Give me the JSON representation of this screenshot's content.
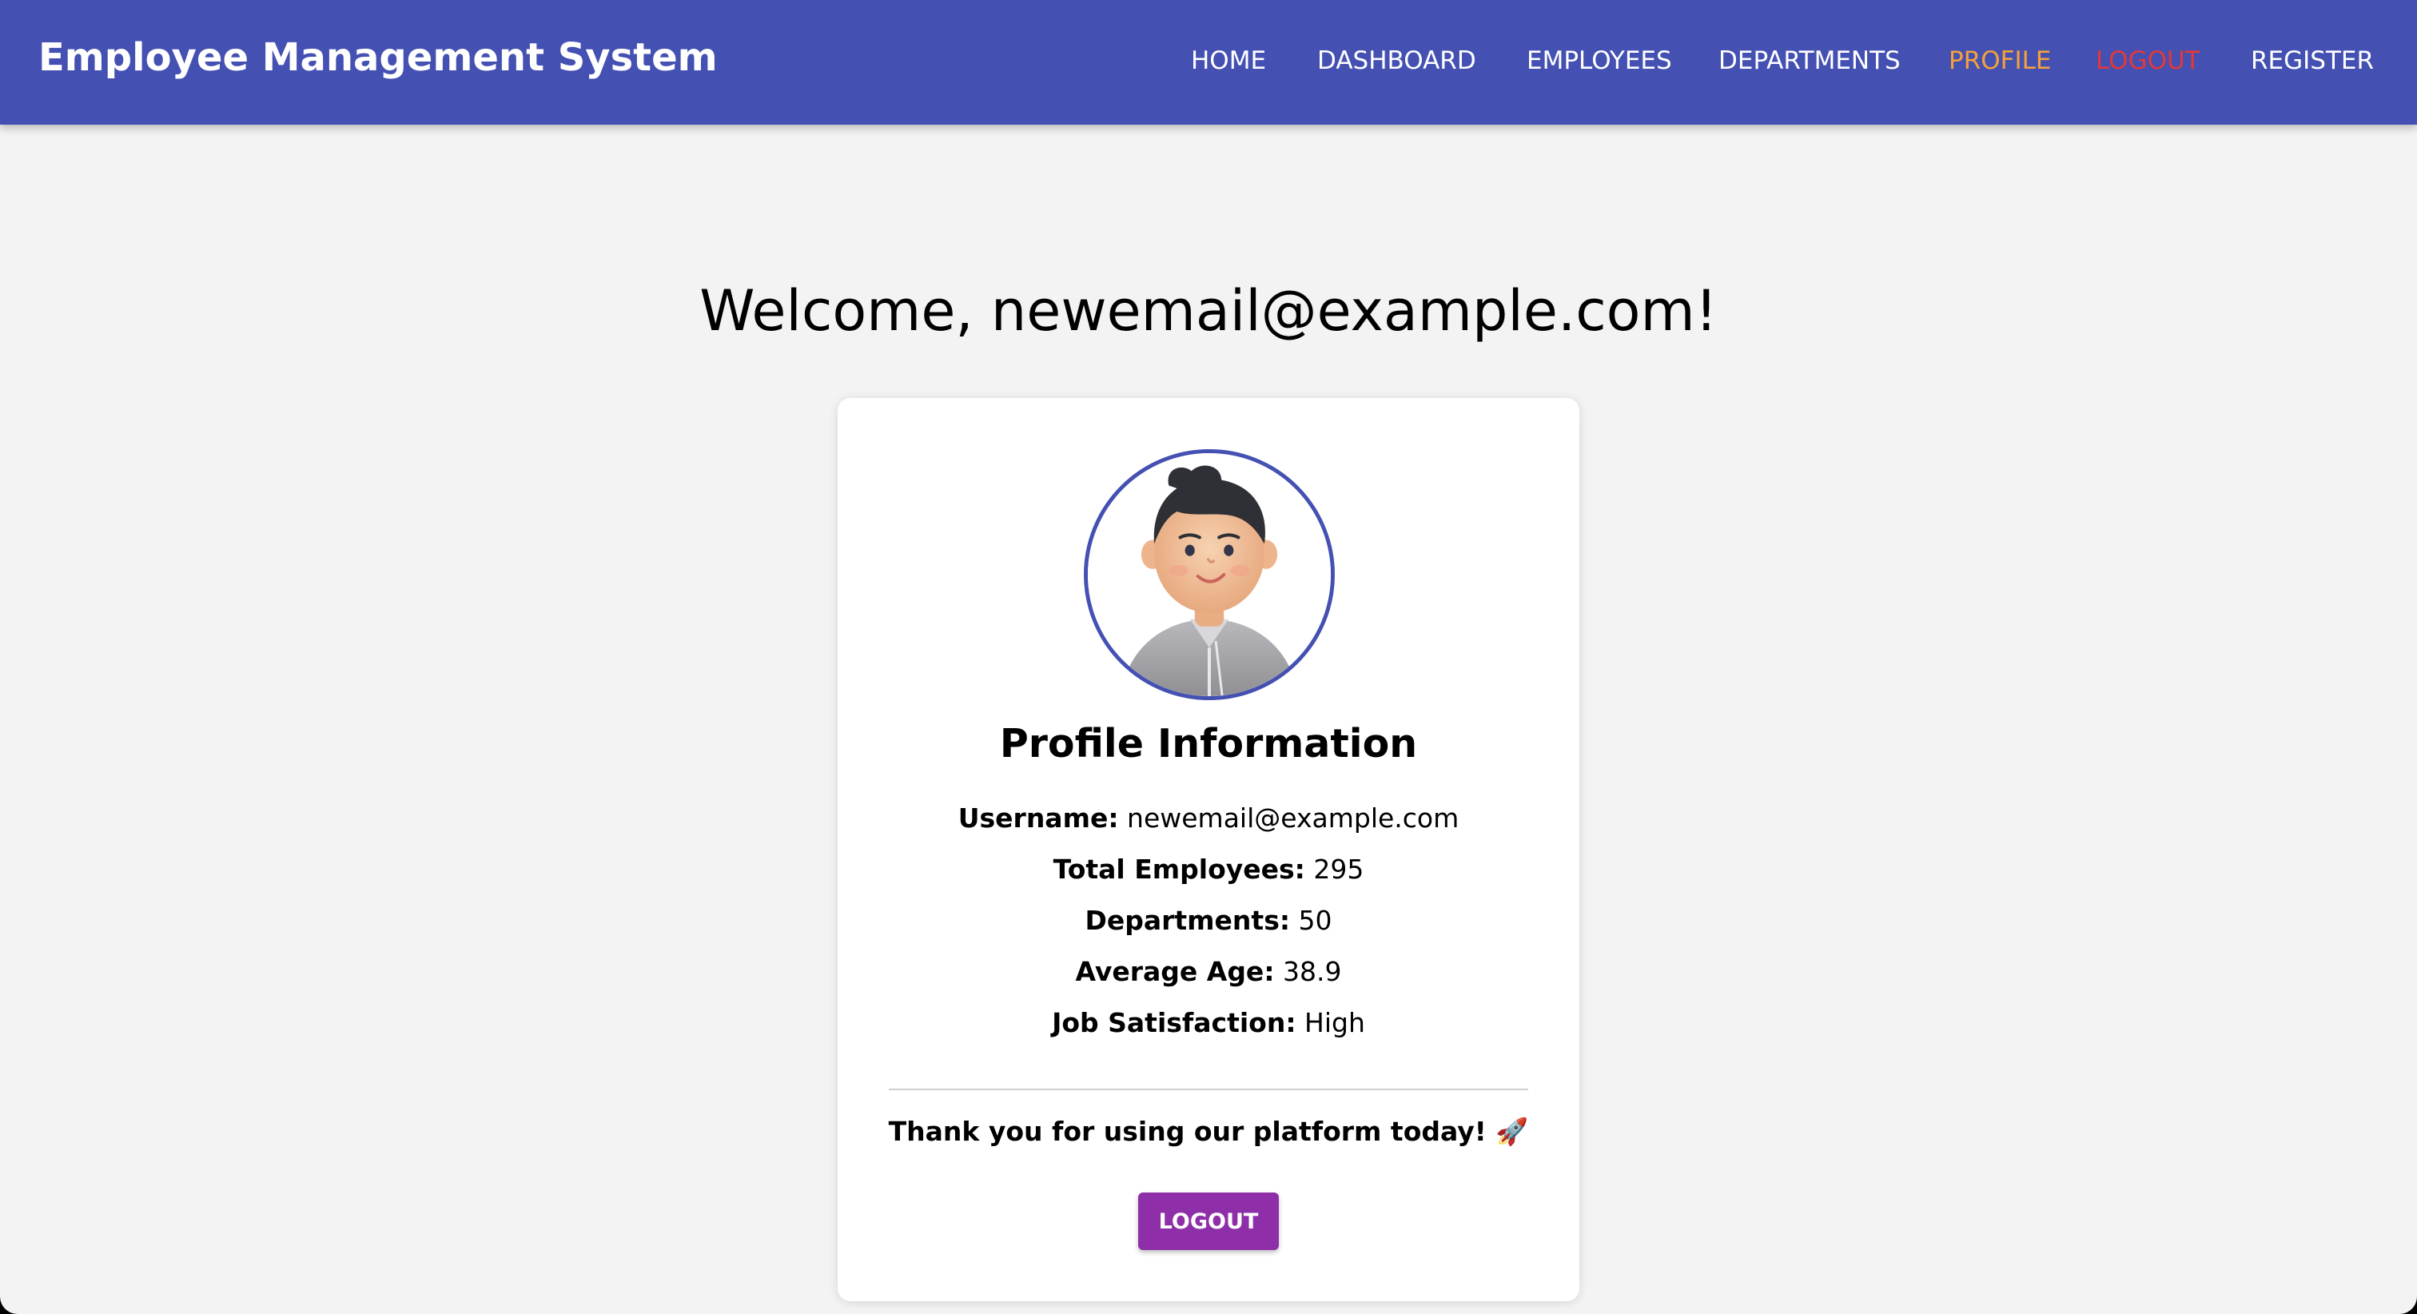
{
  "navbar": {
    "brand": "Employee Management System",
    "items": [
      {
        "label": "HOME"
      },
      {
        "label": "DASHBOARD"
      },
      {
        "label": "EMPLOYEES"
      },
      {
        "label": "DEPARTMENTS"
      },
      {
        "label": "PROFILE",
        "state": "active",
        "color": "#f4a13a"
      },
      {
        "label": "LOGOUT",
        "color": "#e33838"
      },
      {
        "label": "REGISTER"
      }
    ],
    "background": "#4450b2"
  },
  "welcome": "Welcome, newemail@example.com!",
  "profile": {
    "avatar": "avatar-illustration",
    "title": "Profile Information",
    "fields": [
      {
        "label": "Username:",
        "value": "newemail@example.com"
      },
      {
        "label": "Total Employees:",
        "value": "295"
      },
      {
        "label": "Departments:",
        "value": "50"
      },
      {
        "label": "Average Age:",
        "value": "38.9"
      },
      {
        "label": "Job Satisfaction:",
        "value": "High"
      }
    ],
    "thanks": "Thank you for using our platform today! 🚀",
    "logout_button": "LOGOUT",
    "button_color": "#8e2ea8"
  }
}
